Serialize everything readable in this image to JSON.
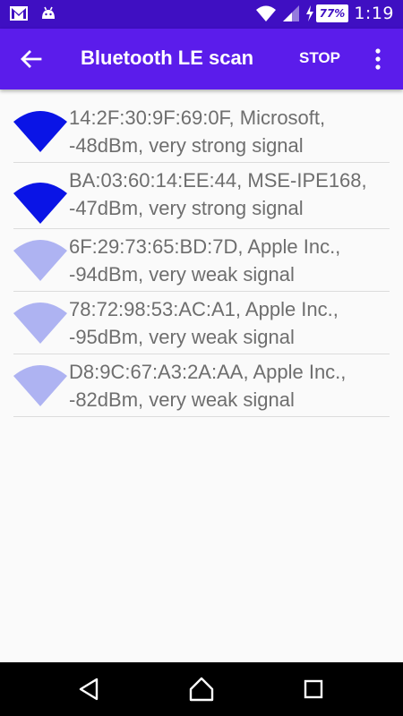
{
  "status_bar": {
    "time": "1:19",
    "battery": "77%",
    "icons": [
      "gmail-icon",
      "android-icon",
      "wifi-icon",
      "cell-signal-icon",
      "charging-icon",
      "battery-icon"
    ]
  },
  "app_bar": {
    "title": "Bluetooth LE scan",
    "action_label": "STOP",
    "colors": {
      "app_bar": "#5B1CEB",
      "status_bar": "#3F0FC2"
    }
  },
  "devices": [
    {
      "text": "14:2F:30:9F:69:0F, Microsoft, -48dBm, very strong signal",
      "strength": "strong",
      "icon_color": "#0A14E6"
    },
    {
      "text": "BA:03:60:14:EE:44, MSE-IPE168, -47dBm, very strong signal",
      "strength": "strong",
      "icon_color": "#0A14E6"
    },
    {
      "text": "6F:29:73:65:BD:7D, Apple Inc., -94dBm, very weak signal",
      "strength": "weak",
      "icon_color": "#AEB3F2"
    },
    {
      "text": "78:72:98:53:AC:A1, Apple Inc., -95dBm, very weak signal",
      "strength": "weak",
      "icon_color": "#AEB3F2"
    },
    {
      "text": "D8:9C:67:A3:2A:AA, Apple Inc., -82dBm, very weak signal",
      "strength": "weak",
      "icon_color": "#AEB3F2"
    }
  ],
  "nav_bar": {
    "buttons": [
      "back-nav-icon",
      "home-nav-icon",
      "recents-nav-icon"
    ]
  }
}
